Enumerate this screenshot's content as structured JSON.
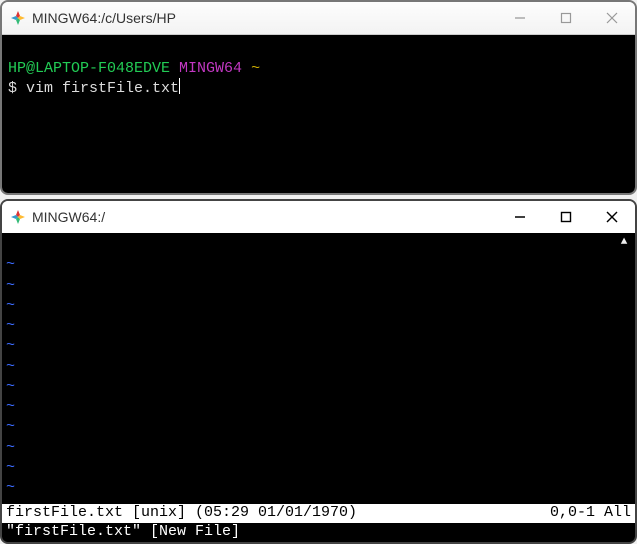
{
  "window1": {
    "title": "MINGW64:/c/Users/HP",
    "prompt_user": "HP@LAPTOP-F048EDVE",
    "prompt_env": "MINGW64",
    "prompt_path": "~",
    "prompt_symbol": "$",
    "command": "vim firstFile.txt"
  },
  "window2": {
    "title": "MINGW64:/",
    "tilde": "~",
    "status_left": "firstFile.txt [unix] (05:29 01/01/1970)",
    "status_right": "0,0-1 All",
    "footer": "\"firstFile.txt\" [New File]",
    "scroll_glyph": "▲"
  },
  "win_controls": {
    "minimize": "—",
    "maximize": "☐",
    "close": "✕"
  }
}
